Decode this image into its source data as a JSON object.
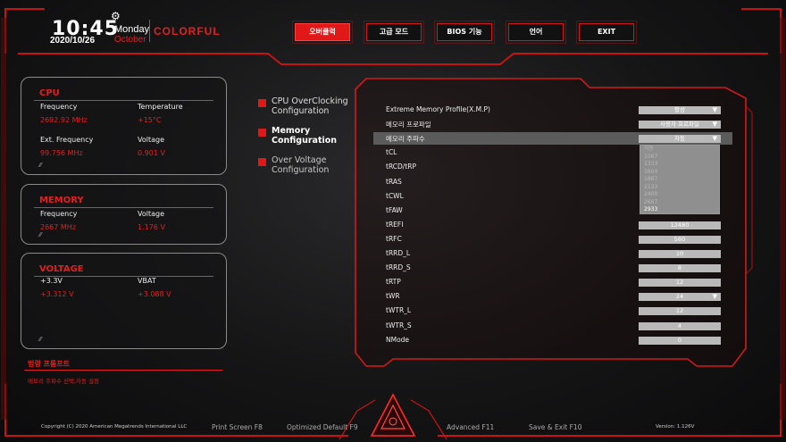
{
  "clock": {
    "time": "10:45",
    "date": "2020/10/26",
    "weekday": "Monday",
    "month": "October"
  },
  "brand": "COLORFUL",
  "top_buttons": [
    {
      "label": "오버클럭",
      "active": true
    },
    {
      "label": "고급 모드",
      "active": false
    },
    {
      "label": "BIOS 기능",
      "active": false
    },
    {
      "label": "언어",
      "active": false
    },
    {
      "label": "EXIT",
      "active": false
    }
  ],
  "cpu": {
    "title": "CPU",
    "freq_label": "Frequency",
    "freq_value": "2692.92 MHz",
    "temp_label": "Temperature",
    "temp_value": "+15°C",
    "ext_label": "Ext. Frequency",
    "ext_value": "99.756 MHz",
    "volt_label": "Voltage",
    "volt_value": "0.901 V"
  },
  "memory": {
    "title": "MEMORY",
    "freq_label": "Frequency",
    "freq_value": "2667 MHz",
    "volt_label": "Voltage",
    "volt_value": "1.176 V"
  },
  "voltage": {
    "title": "VOLTAGE",
    "v33_label": "+3.3V",
    "v33_value": "+3.312 V",
    "vbat_label": "VBAT",
    "vbat_value": "+3.088 V"
  },
  "menu": [
    {
      "label": "CPU OverClocking Configuration",
      "state": "normal"
    },
    {
      "label": "Memory Configuration",
      "state": "active"
    },
    {
      "label": "Over Voltage Configuration",
      "state": "dim"
    }
  ],
  "settings": [
    {
      "label": "Extreme Memory Profile(X.M.P)",
      "value": "활성",
      "dropdown": true
    },
    {
      "label": "메모리 프로파일",
      "value": "사용자 프로파일",
      "dropdown": true
    },
    {
      "label": "메모리 주파수",
      "value": "자동",
      "dropdown": true,
      "highlight": true
    },
    {
      "label": "tCL",
      "value": ""
    },
    {
      "label": "tRCD/tRP",
      "value": ""
    },
    {
      "label": "tRAS",
      "value": ""
    },
    {
      "label": "tCWL",
      "value": ""
    },
    {
      "label": "tFAW",
      "value": ""
    },
    {
      "label": "tREFI",
      "value": "12480"
    },
    {
      "label": "tRFC",
      "value": "560"
    },
    {
      "label": "tRRD_L",
      "value": "10"
    },
    {
      "label": "tRRD_S",
      "value": "8"
    },
    {
      "label": "tRTP",
      "value": "12"
    },
    {
      "label": "tWR",
      "value": "24",
      "dropdown": true
    },
    {
      "label": "tWTR_L",
      "value": "12"
    },
    {
      "label": "tWTR_S",
      "value": "4"
    },
    {
      "label": "NMode",
      "value": "0"
    }
  ],
  "freq_options": [
    "자동",
    "1067",
    "1333",
    "1600",
    "1867",
    "2133",
    "2400",
    "2667",
    "2933"
  ],
  "freq_selected": "2933",
  "help": {
    "title": "범령 프롬프트",
    "text": "메모리 주파수 선택,자동 설정"
  },
  "footer": {
    "copyright": "Copyright (C) 2020 American Megatrends International LLC",
    "print": "Print Screen F8",
    "optimized": "Optimized Default F9",
    "advanced": "Advanced F11",
    "save": "Save & Exit F10",
    "version": "Version: 1.126V"
  },
  "colors": {
    "accent": "#e01818",
    "panel_border": "#8a8a8a",
    "field": "#b9b9b9"
  }
}
